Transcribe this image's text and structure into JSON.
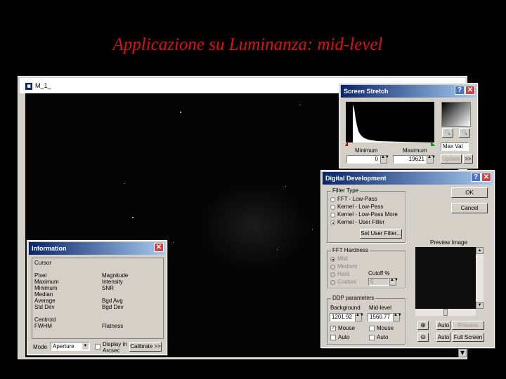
{
  "slide": {
    "title": "Applicazione  su Luminanza: mid-level"
  },
  "image_window": {
    "title": "M_1_",
    "scroll_down": "▼"
  },
  "screen_stretch": {
    "title": "Screen Stretch",
    "help_btn": "?",
    "close_btn": "✕",
    "minimum_label": "Minimum",
    "maximum_label": "Maximum",
    "minimum_value": "0",
    "maximum_value": "19621",
    "mode_select": "Max Val",
    "update_btn": "Update",
    "expand_btn": ">>",
    "zoom_in_icon": "🔍",
    "zoom_out_icon": "🔍"
  },
  "information": {
    "title": "Information",
    "close_btn": "✕",
    "cursor_label": "Cursor",
    "left_labels": [
      "Pixel",
      "Maximum",
      "Minimum",
      "Median",
      "Average",
      "Std Dev",
      "",
      "Centroid",
      "FWHM"
    ],
    "right_labels": [
      "Magnitude",
      "Intensity",
      "SNR",
      "",
      "Bgd Avg",
      "Bgd Dev",
      "",
      "",
      "Flatness"
    ],
    "mode_label": "Mode",
    "mode_value": "Aperture",
    "display_label": "Display in Arcsec",
    "calibrate_btn": "Calibrate >>"
  },
  "digital_development": {
    "title": "Digital Development",
    "help_btn": "?",
    "close_btn": "✕",
    "filter_group": "Filter Type",
    "filters": [
      "FFT - Low-Pass",
      "Kernel - Low-Pass",
      "Kernel - Low-Pass More",
      "Kernel - User Filter"
    ],
    "set_user_filter_btn": "Set User Filter...",
    "ok_btn": "OK",
    "cancel_btn": "Cancel",
    "preview_label": "Preview Image",
    "fft_group": "FFT Hardness",
    "fft_options": [
      "Mild",
      "Medium",
      "Hard",
      "Custom"
    ],
    "cutoff_label": "Cutoff %",
    "cutoff_value": "5",
    "ddp_group": "DDP parameters",
    "background_label": "Background",
    "midlevel_label": "Mid-level",
    "background_value": "1201.92",
    "midlevel_value": "1560.77",
    "mouse_label_1": "Mouse",
    "mouse_label_2": "Mouse",
    "auto_label_1": "Auto",
    "auto_label_2": "Auto",
    "auto_btn_1": "Auto",
    "preview_btn": "Preview",
    "auto_btn_2": "Auto",
    "fullscreen_btn": "Full Screen"
  }
}
